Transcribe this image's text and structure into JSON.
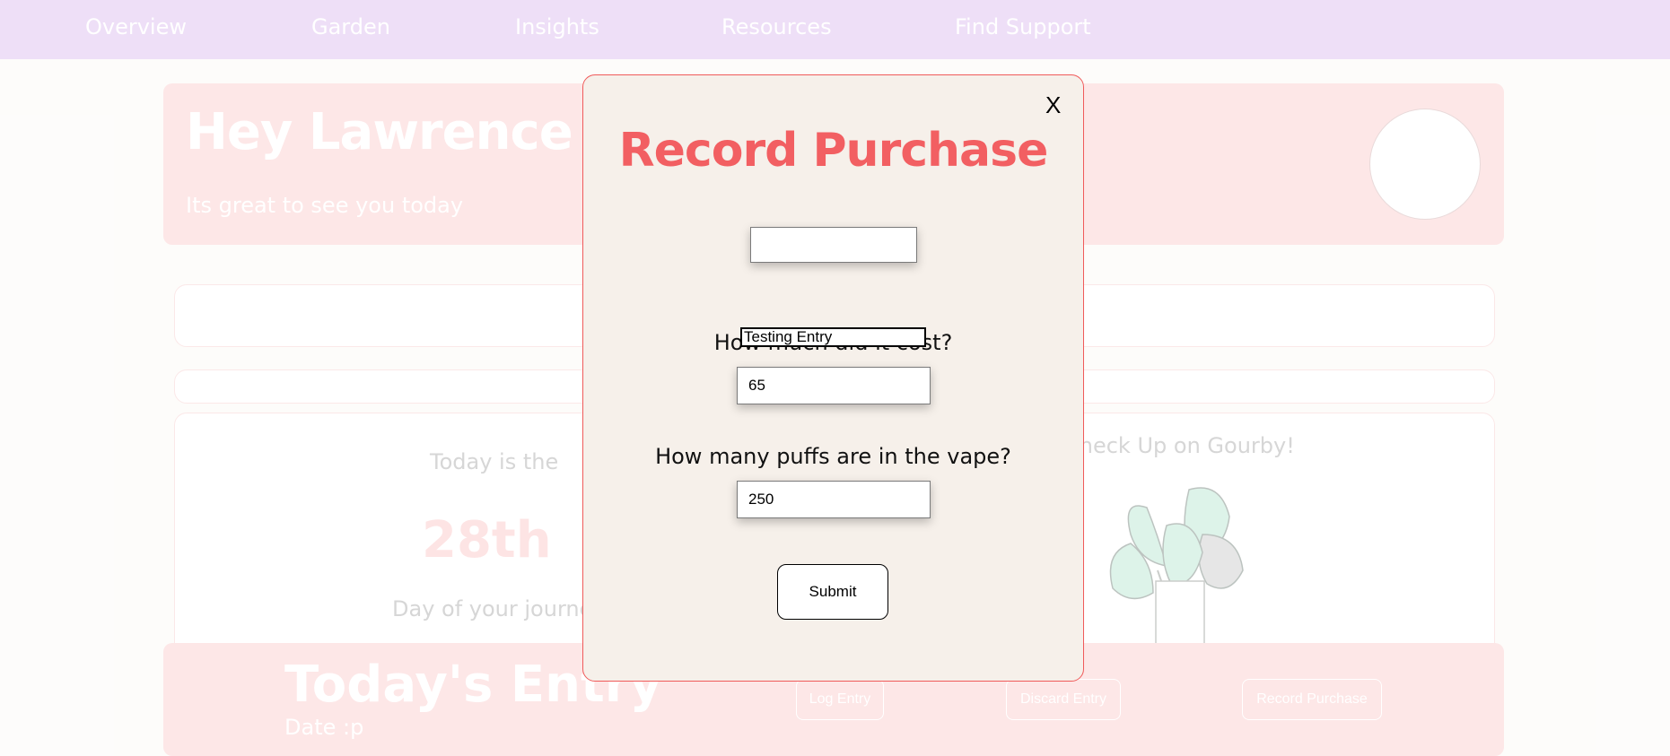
{
  "nav": {
    "items": [
      "Overview",
      "Garden",
      "Insights",
      "Resources",
      "Find Support"
    ]
  },
  "greeting": {
    "title": "Hey Lawrence",
    "subtitle": "Its great to see you today"
  },
  "journey": {
    "prefix": "Today is the",
    "day": "28th",
    "suffix": "Day of your journey"
  },
  "checkup": {
    "label": "Check Up on Gourby!"
  },
  "entry": {
    "title": "Today's Entry",
    "date": "Date :p",
    "log_label": "Log Entry",
    "discard_label": "Discard Entry",
    "record_label": "Record Purchase"
  },
  "modal": {
    "close_label": "X",
    "title": "Record Purchase",
    "top_input_value": "",
    "entry_input_value": "Testing Entry",
    "cost_label": "How much did it cost?",
    "cost_value": "65",
    "puffs_label": "How many puffs are in the vape?",
    "puffs_value": "250",
    "submit_label": "Submit"
  },
  "colors": {
    "nav_bg": "#ecdaf6",
    "card_bg": "#fde3e3",
    "modal_bg": "#f6f0ea",
    "accent": "#f25f62"
  }
}
